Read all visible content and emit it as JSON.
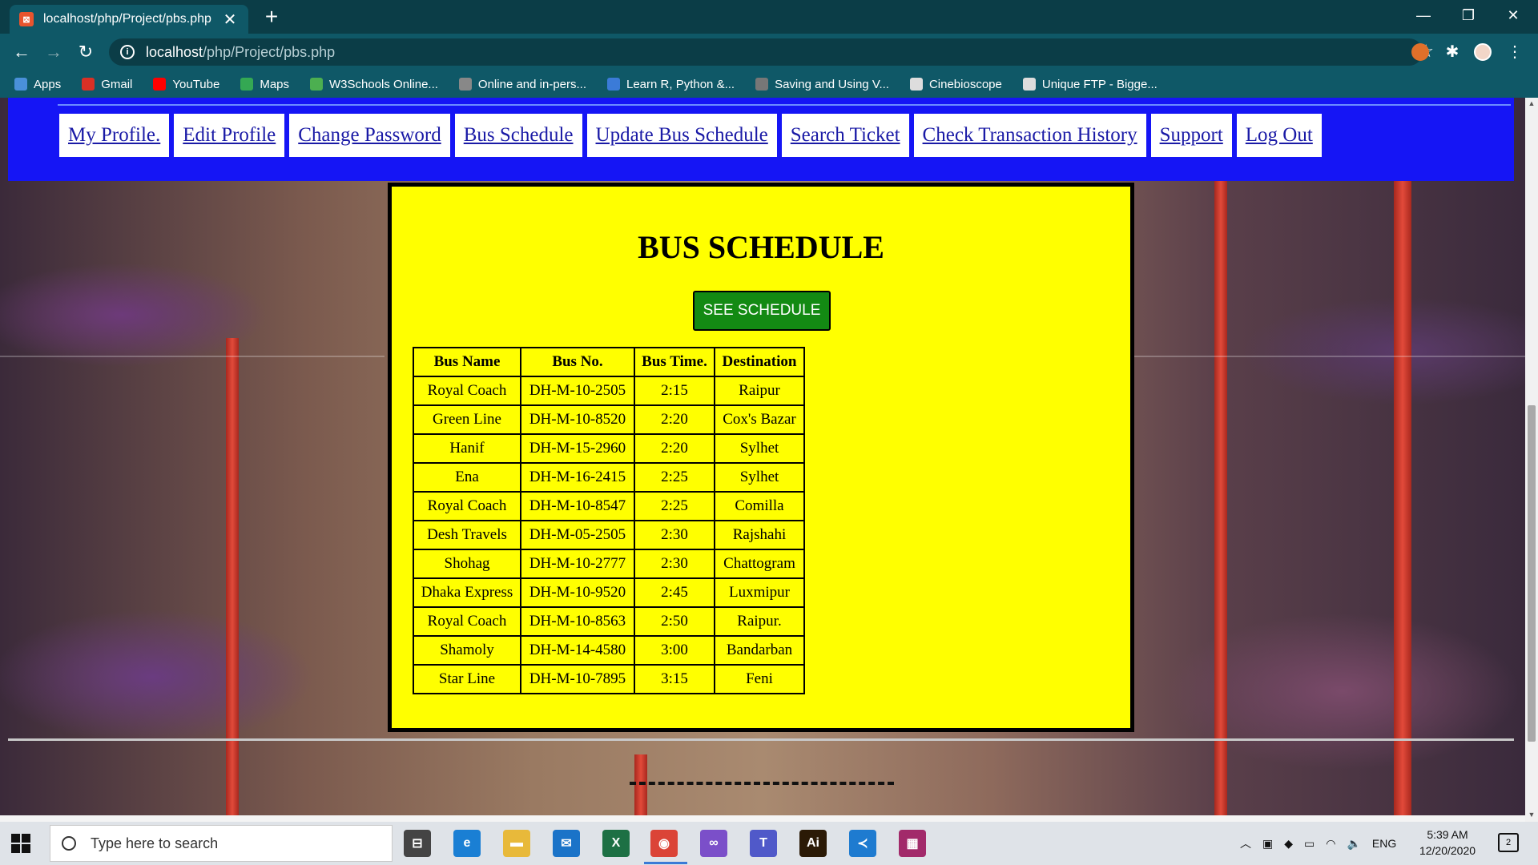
{
  "browser": {
    "tab_title": "localhost/php/Project/pbs.php",
    "tab_close": "✕",
    "new_tab": "+",
    "url_host": "localhost",
    "url_path": "/php/Project/pbs.php",
    "window_minimize": "—",
    "window_restore": "❐",
    "window_close": "✕",
    "back": "←",
    "forward": "→",
    "reload": "↻",
    "star": "☆",
    "bookmarks": [
      {
        "label": "Apps",
        "icon": "apps-grid-icon",
        "color": "#4a90d9"
      },
      {
        "label": "Gmail",
        "icon": "gmail-icon",
        "color": "#d93025"
      },
      {
        "label": "YouTube",
        "icon": "youtube-icon",
        "color": "#ff0000"
      },
      {
        "label": "Maps",
        "icon": "maps-icon",
        "color": "#34a853"
      },
      {
        "label": "W3Schools Online...",
        "icon": "w3schools-icon",
        "color": "#4caf50"
      },
      {
        "label": "Online and in-pers...",
        "icon": "globe-icon",
        "color": "#888888"
      },
      {
        "label": "Learn R, Python &...",
        "icon": "shield-icon",
        "color": "#3b7bd8"
      },
      {
        "label": "Saving and Using V...",
        "icon": "feather-icon",
        "color": "#777777"
      },
      {
        "label": "Cinebioscope",
        "icon": "globe-icon",
        "color": "#dddddd"
      },
      {
        "label": "Unique FTP - Bigge...",
        "icon": "globe-icon",
        "color": "#dddddd"
      }
    ]
  },
  "nav": {
    "links": [
      "My Profile.",
      "Edit Profile",
      "Change Password",
      "Bus Schedule",
      "Update Bus Schedule",
      "Search Ticket",
      "Check Transaction History",
      "Support",
      "Log Out"
    ]
  },
  "schedule": {
    "title": "BUS SCHEDULE",
    "button": "SEE SCHEDULE",
    "headers": [
      "Bus Name",
      "Bus No.",
      "Bus Time.",
      "Destination"
    ],
    "rows": [
      [
        "Royal Coach",
        "DH-M-10-2505",
        "2:15",
        "Raipur"
      ],
      [
        "Green Line",
        "DH-M-10-8520",
        "2:20",
        "Cox's Bazar"
      ],
      [
        "Hanif",
        "DH-M-15-2960",
        "2:20",
        "Sylhet"
      ],
      [
        "Ena",
        "DH-M-16-2415",
        "2:25",
        "Sylhet"
      ],
      [
        "Royal Coach",
        "DH-M-10-8547",
        "2:25",
        "Comilla"
      ],
      [
        "Desh Travels",
        "DH-M-05-2505",
        "2:30",
        "Rajshahi"
      ],
      [
        "Shohag",
        "DH-M-10-2777",
        "2:30",
        "Chattogram"
      ],
      [
        "Dhaka Express",
        "DH-M-10-9520",
        "2:45",
        "Luxmipur"
      ],
      [
        "Royal Coach",
        "DH-M-10-8563",
        "2:50",
        "Raipur."
      ],
      [
        "Shamoly",
        "DH-M-14-4580",
        "3:00",
        "Bandarban"
      ],
      [
        "Star Line",
        "DH-M-10-7895",
        "3:15",
        "Feni"
      ]
    ]
  },
  "taskbar": {
    "search_placeholder": "Type here to search",
    "language": "ENG",
    "time": "5:39 AM",
    "date": "12/20/2020",
    "notification_count": "2",
    "apps": [
      {
        "name": "task-view-icon",
        "glyph": "⊟",
        "color": "#444444"
      },
      {
        "name": "edge-icon",
        "glyph": "e",
        "color": "#1a7fd4"
      },
      {
        "name": "file-explorer-icon",
        "glyph": "▬",
        "color": "#e8b93a"
      },
      {
        "name": "mail-icon",
        "glyph": "✉",
        "color": "#1a73c8"
      },
      {
        "name": "excel-icon",
        "glyph": "X",
        "color": "#1d7044"
      },
      {
        "name": "chrome-icon",
        "glyph": "◉",
        "color": "#db4437"
      },
      {
        "name": "visual-studio-icon",
        "glyph": "∞",
        "color": "#7b4fc9"
      },
      {
        "name": "teams-icon",
        "glyph": "T",
        "color": "#5059c9"
      },
      {
        "name": "illustrator-icon",
        "glyph": "Ai",
        "color": "#2b1a06"
      },
      {
        "name": "vscode-icon",
        "glyph": "≺",
        "color": "#1e7bd0"
      },
      {
        "name": "winrar-icon",
        "glyph": "▦",
        "color": "#a22a6a"
      }
    ]
  }
}
